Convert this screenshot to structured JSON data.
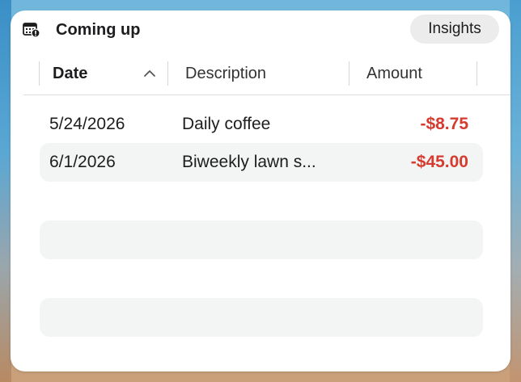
{
  "widget": {
    "title": "Coming up",
    "insights_label": "Insights",
    "icon": "calendar-alert-icon"
  },
  "columns": [
    {
      "label": "Date",
      "sorted": "ascending"
    },
    {
      "label": "Description"
    },
    {
      "label": "Amount"
    }
  ],
  "rows": [
    {
      "date": "5/24/2026",
      "description": "Daily coffee",
      "amount": "-$8.75"
    },
    {
      "date": "6/1/2026",
      "description": "Biweekly lawn s...",
      "amount": "-$45.00"
    },
    {
      "date": "",
      "description": "",
      "amount": ""
    },
    {
      "date": "",
      "description": "",
      "amount": ""
    },
    {
      "date": "",
      "description": "",
      "amount": ""
    }
  ],
  "colors": {
    "negative_amount": "#d63b2f",
    "row_stripe": "#f3f4f4",
    "button_bg": "#ececec"
  }
}
